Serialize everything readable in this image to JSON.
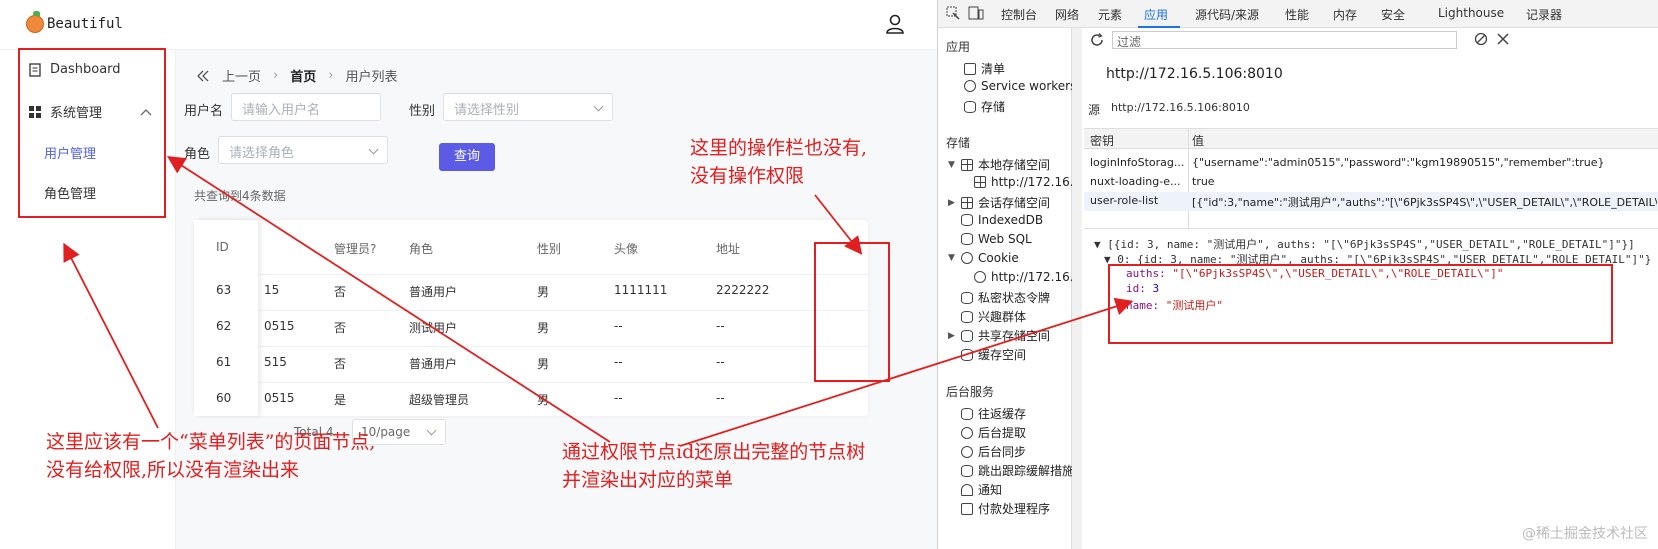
{
  "app": {
    "brand": "Beautiful",
    "sidebar": {
      "dashboard": "Dashboard",
      "system": "系统管理",
      "sub_items": [
        "用户管理",
        "角色管理"
      ]
    },
    "breadcrumb": {
      "back": "上一页",
      "home": "首页",
      "current": "用户列表"
    },
    "filters": {
      "username_label": "用户名",
      "username_placeholder": "请输入用户名",
      "gender_label": "性别",
      "gender_placeholder": "请选择性别",
      "role_label": "角色",
      "role_placeholder": "请选择角色",
      "query_button": "查询"
    },
    "result_count": "共查询到4条数据",
    "table": {
      "headers": [
        "ID",
        "管理员?",
        "角色",
        "性别",
        "头像",
        "地址"
      ],
      "rows": [
        {
          "id": "63",
          "username": "15",
          "admin": "否",
          "role": "普通用户",
          "gender": "男",
          "avatar": "1111111",
          "address": "2222222"
        },
        {
          "id": "62",
          "username": "0515",
          "admin": "否",
          "role": "测试用户",
          "gender": "男",
          "avatar": "--",
          "address": "--"
        },
        {
          "id": "61",
          "username": "515",
          "admin": "否",
          "role": "普通用户",
          "gender": "男",
          "avatar": "--",
          "address": "--"
        },
        {
          "id": "60",
          "username": "0515",
          "admin": "是",
          "role": "超级管理员",
          "gender": "男",
          "avatar": "--",
          "address": "--"
        }
      ]
    },
    "pager": {
      "total": "Total 4",
      "page_size": "10/page"
    }
  },
  "devtools": {
    "tabs": [
      "控制台",
      "网络",
      "元素",
      "应用",
      "源代码/来源",
      "性能",
      "内存",
      "安全",
      "Lighthouse",
      "记录器"
    ],
    "active_tab": "应用",
    "side": {
      "app_section": "应用",
      "app_items": [
        "清单",
        "Service workers",
        "存储"
      ],
      "storage_section": "存储",
      "storage_items": [
        "本地存储空间",
        "http://172.16.5",
        "会话存储空间",
        "IndexedDB",
        "Web SQL",
        "Cookie",
        "http://172.16.5",
        "私密状态令牌",
        "兴趣群体",
        "共享存储空间",
        "缓存空间"
      ],
      "bg_section": "后台服务",
      "bg_items": [
        "往返缓存",
        "后台提取",
        "后台同步",
        "跳出跟踪缓解措施",
        "通知",
        "付款处理程序"
      ]
    },
    "filter_placeholder": "过滤",
    "origin_url": "http://172.16.5.106:8010",
    "source_label": "源",
    "source_url": "http://172.16.5.106:8010",
    "kv_headers": [
      "密钥",
      "值"
    ],
    "kv_rows": [
      {
        "key": "loginInfoStorag...",
        "value": "{\"username\":\"admin0515\",\"password\":\"kgm19890515\",\"remember\":true}"
      },
      {
        "key": "nuxt-loading-e...",
        "value": "true"
      },
      {
        "key": "user-role-list",
        "value": "[{\"id\":3,\"name\":\"测试用户\",\"auths\":\"[\\\"6Pjk3sSP4S\\\",\\\"USER_DETAIL\\\",\\\"ROLE_DETAIL\\\"]\"}]"
      }
    ],
    "json_preview": {
      "line1": "▼ [{id: 3, name: \"测试用户\", auths: \"[\\\"6Pjk3sSP4S\",\"USER_DETAIL\",\"ROLE_DETAIL\"]\"}]",
      "line2": "▼ 0: {id: 3, name: \"测试用户\", auths: \"[\\\"6Pjk3sSP4S\",\"USER_DETAIL\",\"ROLE_DETAIL\"]\"}",
      "auths_key": "auths:",
      "auths_val": "\"[\\\"6Pjk3sSP4S\\\",\\\"USER_DETAIL\\\",\\\"ROLE_DETAIL\\\"]\"",
      "id_key": "id:",
      "id_val": "3",
      "name_key": "name:",
      "name_val": "\"测试用户\""
    }
  },
  "annotations": {
    "op_col_note": [
      "这里的操作栏也没有,",
      "没有操作权限"
    ],
    "menu_note": [
      "这里应该有一个“菜单列表”的页面节点,",
      "没有给权限,所以没有渲染出来"
    ],
    "tree_note": [
      "通过权限节点id还原出完整的节点树",
      "并渲染出对应的菜单"
    ],
    "color": "#e02020"
  },
  "watermark": "@稀土掘金技术社区"
}
